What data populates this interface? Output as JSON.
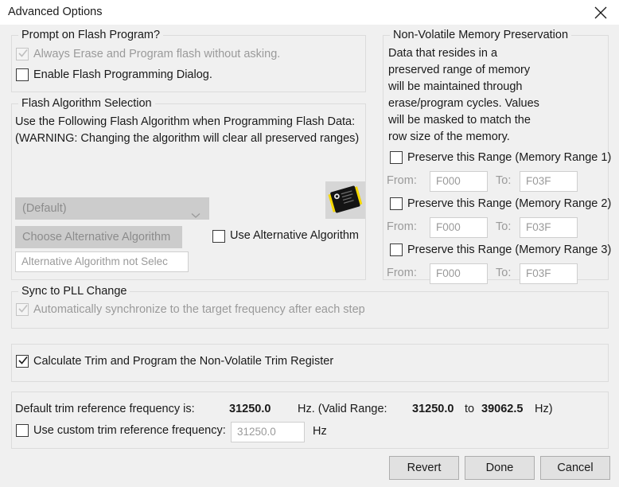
{
  "window": {
    "title": "Advanced Options",
    "close_icon": "close-icon"
  },
  "prompt_group": {
    "title": "Prompt on Flash Program?",
    "always_erase": {
      "label": "Always Erase and Program flash without asking.",
      "checked": true,
      "enabled": false
    },
    "enable_dialog": {
      "label": "Enable Flash Programming Dialog.",
      "checked": false,
      "enabled": true
    }
  },
  "algorithm_group": {
    "title": "Flash Algorithm Selection",
    "description": "Use the Following Flash Algorithm when Programming Flash Data:\n(WARNING: Changing the algorithm will clear all preserved ranges)",
    "combo_value": "(Default)",
    "choose_button": "Choose Alternative Algorithm",
    "status_field": "Alternative Algorithm not Selec",
    "use_alternative": {
      "label": "Use Alternative Algorithm",
      "checked": false
    },
    "chip_icon": "chip-icon"
  },
  "memory_group": {
    "title": "Non-Volatile Memory Preservation",
    "description": "Data that resides in a\npreserved range of memory\nwill be maintained through\nerase/program cycles. Values\nwill be masked to match the\nrow size of the memory.",
    "from_label": "From:",
    "to_label": "To:",
    "ranges": [
      {
        "label": "Preserve this Range (Memory Range 1)",
        "checked": false,
        "from": "F000",
        "to": "F03F"
      },
      {
        "label": "Preserve this Range (Memory Range 2)",
        "checked": false,
        "from": "F000",
        "to": "F03F"
      },
      {
        "label": "Preserve this Range (Memory Range 3)",
        "checked": false,
        "from": "F000",
        "to": "F03F"
      }
    ]
  },
  "pll_group": {
    "title": "Sync to PLL Change",
    "auto_sync": {
      "label": "Automatically synchronize to the target frequency after each step",
      "checked": true,
      "enabled": false
    }
  },
  "trim_group": {
    "calculate_trim": {
      "label": "Calculate Trim and Program the Non-Volatile Trim Register",
      "checked": true
    }
  },
  "frequency_group": {
    "default_label": "Default trim reference frequency is:",
    "default_value": "31250.0",
    "unit_range_prefix": "Hz. (Valid Range:",
    "range_min": "31250.0",
    "range_to": "to",
    "range_max": "39062.5",
    "unit_range_suffix": "Hz)",
    "custom_checkbox": {
      "label": "Use custom trim reference frequency:",
      "checked": false
    },
    "custom_value": "31250.0",
    "custom_unit": "Hz"
  },
  "footer": {
    "revert": "Revert",
    "done": "Done",
    "cancel": "Cancel"
  },
  "colors": {
    "background": "#f0f0f0",
    "titlebar": "#ffffff",
    "border": "#dcdcdc",
    "text": "#1a1a1a",
    "disabled_text": "#9a9a9a",
    "button_face": "#e1e1e1"
  }
}
